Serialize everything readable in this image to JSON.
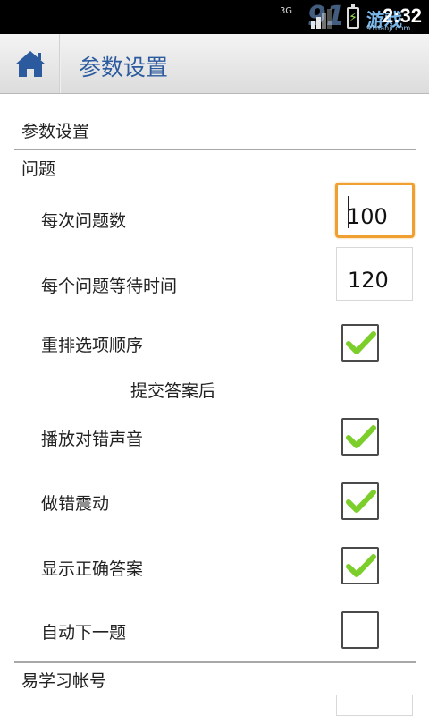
{
  "status_bar": {
    "network": "3G",
    "time": "2:32",
    "watermark_text": "游戏",
    "watermark_url": "91danji.com",
    "watermark_logo": "91"
  },
  "action_bar": {
    "home_icon": "home-icon",
    "title": "参数设置"
  },
  "settings": {
    "header": "参数设置",
    "category_question": "问题",
    "per_question_count": {
      "label": "每次问题数",
      "value": "100"
    },
    "wait_time": {
      "label": "每个问题等待时间",
      "value": "120"
    },
    "shuffle_options": {
      "label": "重排选项顺序",
      "checked": true
    },
    "after_submit_header": "提交答案后",
    "play_sound": {
      "label": "播放对错声音",
      "checked": true
    },
    "vibrate_on_wrong": {
      "label": "做错震动",
      "checked": true
    },
    "show_correct_answer": {
      "label": "显示正确答案",
      "checked": true
    },
    "auto_next": {
      "label": "自动下一题",
      "checked": false
    },
    "category_account": "易学习帐号"
  },
  "colors": {
    "accent_title": "#2b5a9e",
    "focus_border": "#f0a030",
    "checkmark": "#7ccf2a"
  }
}
